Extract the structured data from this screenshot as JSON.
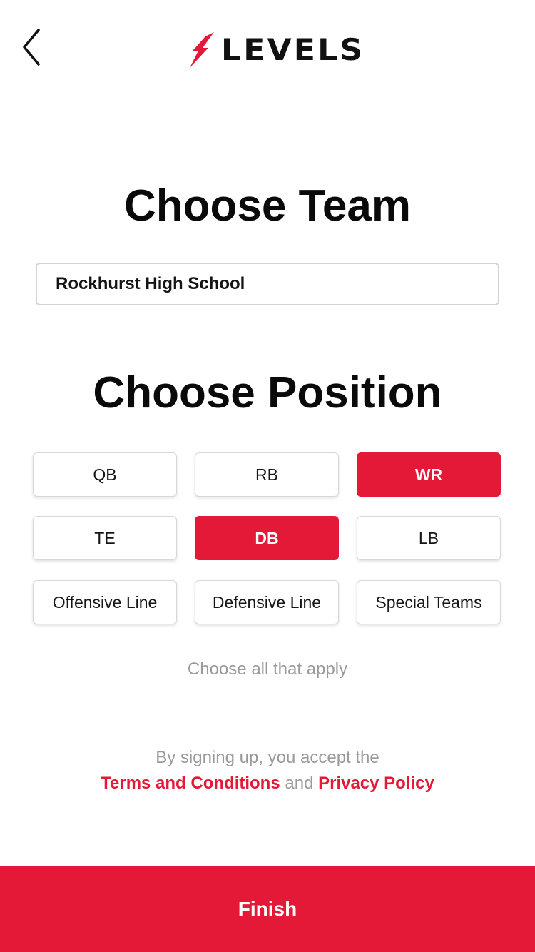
{
  "header": {
    "logo_text": "LEVELS",
    "back_icon": "chevron-left-icon",
    "brand_color": "#e31937"
  },
  "team": {
    "title": "Choose Team",
    "selected_team": "Rockhurst High School"
  },
  "position": {
    "title": "Choose Position",
    "options": [
      {
        "label": "QB",
        "selected": false
      },
      {
        "label": "RB",
        "selected": false
      },
      {
        "label": "WR",
        "selected": true
      },
      {
        "label": "TE",
        "selected": false
      },
      {
        "label": "DB",
        "selected": true
      },
      {
        "label": "LB",
        "selected": false
      },
      {
        "label": "Offensive Line",
        "selected": false
      },
      {
        "label": "Defensive Line",
        "selected": false
      },
      {
        "label": "Special Teams",
        "selected": false
      }
    ],
    "hint": "Choose all that apply"
  },
  "legal": {
    "line1": "By signing up, you accept the",
    "terms_label": "Terms and Conditions",
    "and_text": " and ",
    "privacy_label": "Privacy Policy"
  },
  "footer": {
    "finish_label": "Finish"
  }
}
